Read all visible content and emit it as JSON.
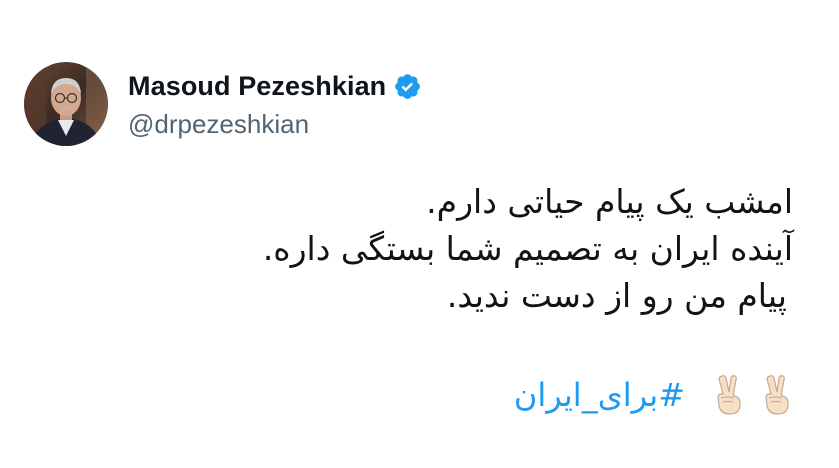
{
  "tweet": {
    "author": {
      "display_name": "Masoud Pezeshkian",
      "handle": "@drpezeshkian",
      "verified": true,
      "avatar_icon": "user-avatar",
      "verified_icon": "verified-badge-icon"
    },
    "body_lines": [
      "امشب یک پیام حیاتی دارم.",
      "آینده ایران به تصمیم شما بستگی داره.",
      "پیام من رو از دست ندید."
    ],
    "hashtag": "#برای_ایران",
    "emojis": [
      "victory-hand-light-skin-icon",
      "victory-hand-light-skin-icon"
    ],
    "colors": {
      "text": "#0f1419",
      "secondary": "#536471",
      "link": "#1d9bf0",
      "verified": "#1d9bf0"
    }
  }
}
